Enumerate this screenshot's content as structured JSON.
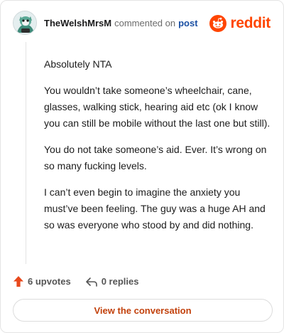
{
  "comment": {
    "author": "TheWelshMrsM",
    "action_text": "commented on",
    "post_link_label": "post",
    "brand": "reddit",
    "paragraphs": [
      "Absolutely NTA",
      "You wouldn’t take someone’s wheelchair, cane, glasses, walking stick, hearing aid etc (ok I know you can still be mobile without the last one but still).",
      "You do not take someone’s aid. Ever. It’s wrong on so many fucking levels.",
      "I can’t even begin to imagine the anxiety you must’ve been feeling. The guy was a huge AH and so was everyone who stood by and did nothing."
    ],
    "upvotes_label": "6 upvotes",
    "replies_label": "0 replies",
    "cta_label": "View the conversation"
  },
  "icons": {
    "avatar": "snoo-avatar-icon",
    "logo": "reddit-logo-icon",
    "upvote": "upvote-arrow-icon",
    "reply": "reply-arrow-icon"
  },
  "colors": {
    "brand": "#ff4500",
    "upvote": "#e8491d",
    "link": "#1a4fa3",
    "cta": "#c2410c"
  }
}
